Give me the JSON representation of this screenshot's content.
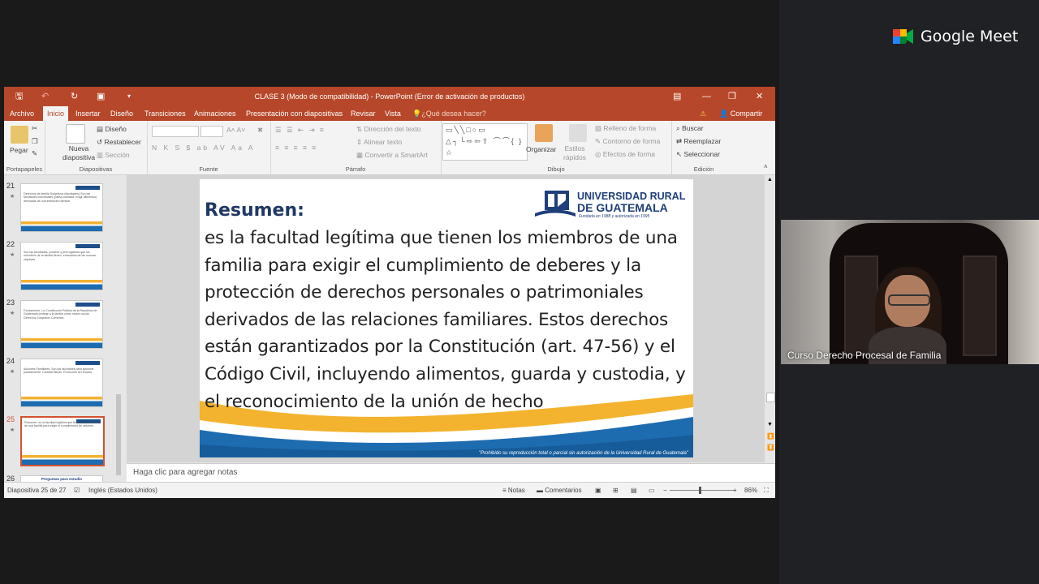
{
  "meet": {
    "brand": "Google Meet",
    "participant_name": "Curso Derecho Procesal de Familia"
  },
  "powerpoint": {
    "window_title": "CLASE 3 (Modo de compatibilidad) - PowerPoint (Error de activación de productos)",
    "tabs": [
      "Archivo",
      "Inicio",
      "Insertar",
      "Diseño",
      "Transiciones",
      "Animaciones",
      "Presentación con diapositivas",
      "Revisar",
      "Vista"
    ],
    "active_tab": "Inicio",
    "tell_me": "¿Qué desea hacer?",
    "share": "Compartir",
    "ribbon": {
      "paste": "Pegar",
      "new_slide": "Nueva diapositiva",
      "layout": "Diseño",
      "reset": "Restablecer",
      "section": "Sección",
      "text_direction": "Dirección del texto",
      "align_text": "Alinear texto",
      "smartart": "Convertir a SmartArt",
      "arrange": "Organizar",
      "quick_styles": "Estilos rápidos",
      "shape_fill": "Relleno de forma",
      "shape_outline": "Contorno de forma",
      "shape_effects": "Efectos de forma",
      "find": "Buscar",
      "replace": "Reemplazar",
      "select": "Seleccionar",
      "groups": {
        "clipboard": "Portapapeles",
        "slides": "Diapositivas",
        "font": "Fuente",
        "paragraph": "Párrafo",
        "drawing": "Dibujo",
        "editing": "Edición"
      }
    },
    "thumbnails": [
      {
        "num": "21",
        "text": "Derechos de familia Subjetivos (facultades) Son las facultades individuales (patria potestad, exigir alimentos) derivadas de una institución familiar."
      },
      {
        "num": "22",
        "text": "Son las facultades, poderes y prerrogativas que los miembros de la familia tienen, emanados de las normas objetivas."
      },
      {
        "num": "23",
        "text": "Fundamento: La Constitución Política de la República de Guatemala protege a la familia como núcleo social. Derechos Subjetivos Comunes."
      },
      {
        "num": "24",
        "text": "Acciones Familiares: Son las facultades para accionar judicialmente. Características. Protección del Estado."
      },
      {
        "num": "25",
        "text": "Resumen: es la facultad legítima que tienen los miembros de una familia para exigir el cumplimiento de deberes."
      },
      {
        "num": "26",
        "text": "Preguntas para estudio"
      }
    ],
    "slide": {
      "heading": "Resumen:",
      "body": "es la facultad legítima que tienen los miembros de una familia para exigir el cumplimiento de deberes y la protección de derechos personales o patrimoniales derivados de las relaciones familiares. Estos derechos están garantizados por la Constitución (art. 47-56) y el Código Civil, incluyendo alimentos, guarda y custodia, y el reconocimiento de la unión de hecho",
      "logo_line1": "UNIVERSIDAD RURAL",
      "logo_line2": "DE GUATEMALA",
      "logo_line3": "Fundada en 1988 y autorizada en 1995",
      "footer": "\"Prohibido su reproducción total o parcial sin autorización de la Universidad Rural de Guatemala\""
    },
    "notes_placeholder": "Haga clic para agregar notas",
    "status": {
      "slide_count": "Diapositiva 25 de 27",
      "language": "Inglés (Estados Unidos)",
      "notes": "Notas",
      "comments": "Comentarios",
      "zoom": "86%"
    }
  }
}
